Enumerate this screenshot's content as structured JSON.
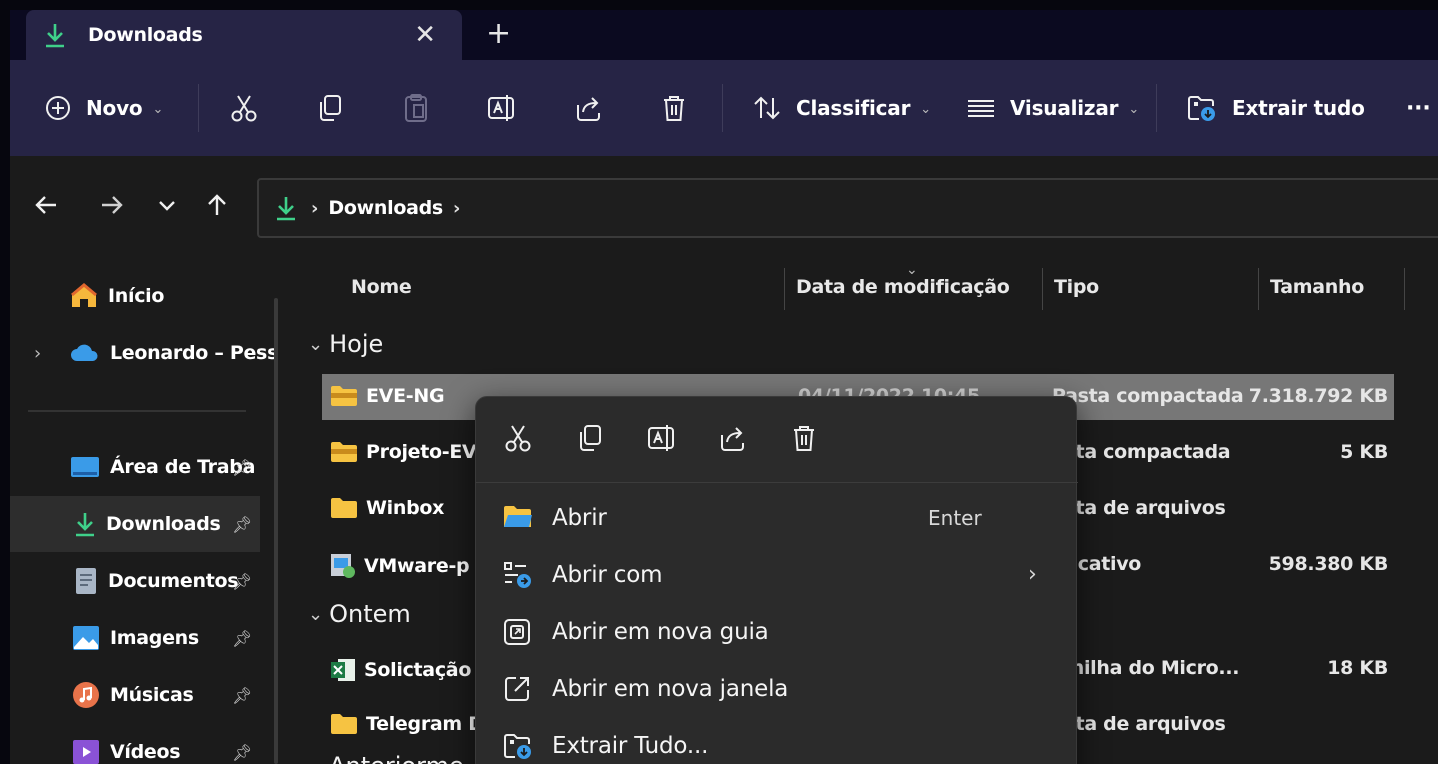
{
  "tab": {
    "title": "Downloads",
    "close_label": "✕",
    "new_tab_label": "+"
  },
  "toolbar": {
    "new_label": "Novo",
    "sort_label": "Classificar",
    "view_label": "Visualizar",
    "extract_label": "Extrair tudo",
    "more_label": "···",
    "caret": "⌄"
  },
  "address": {
    "crumb": "Downloads"
  },
  "sidebar": {
    "items": [
      {
        "label": "Início"
      },
      {
        "label": "Leonardo – Pess"
      },
      {
        "label": "Área de Traba"
      },
      {
        "label": "Downloads"
      },
      {
        "label": "Documentos"
      },
      {
        "label": "Imagens"
      },
      {
        "label": "Músicas"
      },
      {
        "label": "Vídeos"
      }
    ]
  },
  "columns": {
    "name": "Nome",
    "date": "Data de modificação",
    "type": "Tipo",
    "size": "Tamanho"
  },
  "groups": {
    "today": "Hoje",
    "yesterday": "Ontem",
    "earlier": "Anteriorme"
  },
  "files": [
    {
      "name": "EVE-NG",
      "date": "04/11/2022 10:45",
      "type": "Pasta compactada",
      "size": "7.318.792 KB"
    },
    {
      "name": "Projeto-EV",
      "date": "",
      "type": "asta compactada",
      "size": "5 KB"
    },
    {
      "name": "Winbox",
      "date": "",
      "type": "asta de arquivos",
      "size": ""
    },
    {
      "name": "VMware-p",
      "date": "",
      "type": "plicativo",
      "size": "598.380 KB"
    },
    {
      "name": "Solictação",
      "date": "",
      "type": "lanilha do Micro...",
      "size": "18 KB"
    },
    {
      "name": "Telegram D",
      "date": "",
      "type": "asta de arquivos",
      "size": ""
    }
  ],
  "context_menu": {
    "items": [
      {
        "label": "Abrir",
        "shortcut": "Enter"
      },
      {
        "label": "Abrir com",
        "arrow": "›"
      },
      {
        "label": "Abrir em nova guia"
      },
      {
        "label": "Abrir em nova janela"
      },
      {
        "label": "Extrair Tudo..."
      }
    ]
  },
  "colors": {
    "accent_green": "#3fd08a",
    "folder_yellow": "#f6c342",
    "onedrive_blue": "#3a9be8",
    "toolbar_bg": "#262445",
    "selected_row": "#777777"
  }
}
